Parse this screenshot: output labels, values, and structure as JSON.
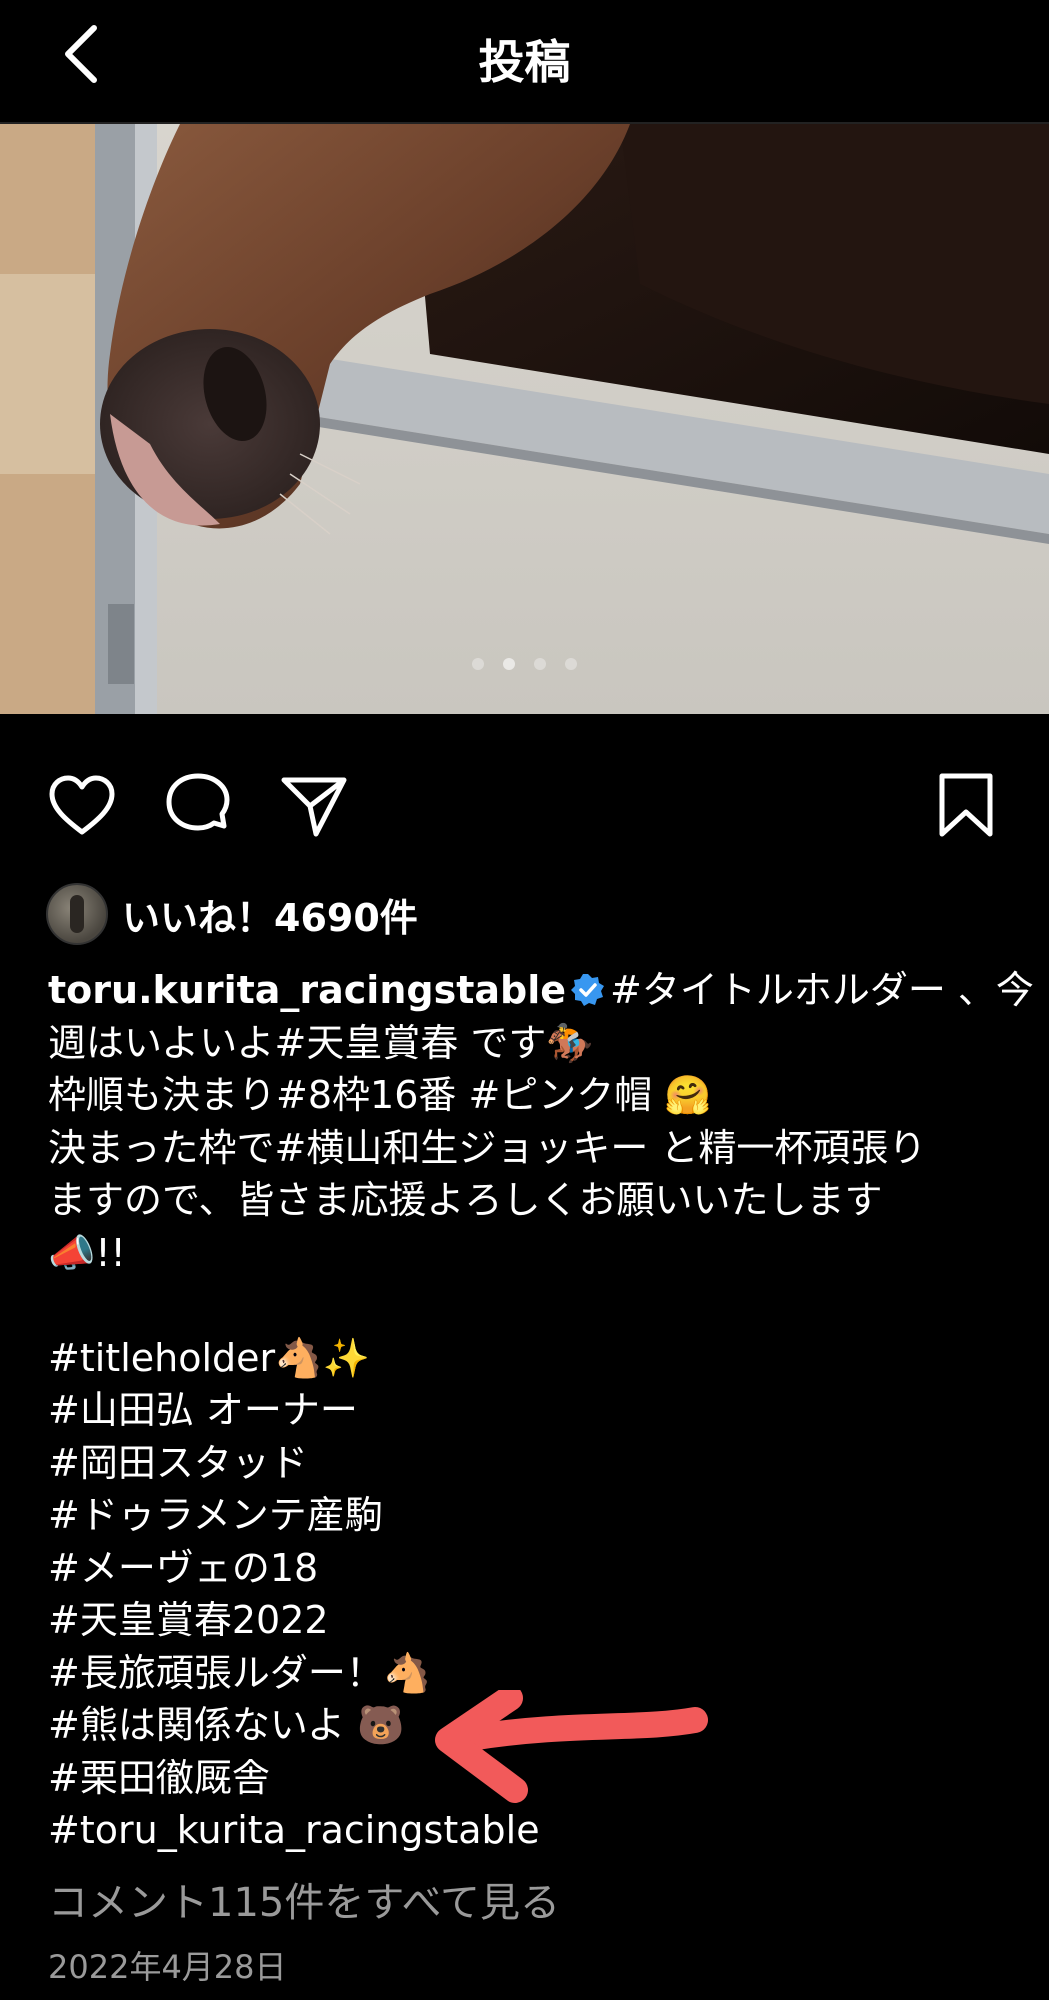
{
  "header": {
    "title": "投稿"
  },
  "photo": {
    "dots": 4,
    "active_dot": 2
  },
  "likes": {
    "text": "いいね！4690件"
  },
  "caption": {
    "username": "toru.kurita_racingstable",
    "lines": [
      "#タイトルホルダー 、今",
      "週はいよいよ#天皇賞春 です🏇",
      "枠順も決まり#8枠16番 #ピンク帽 🤗",
      "決まった枠で#横山和生ジョッキー と精一杯頑張り",
      "ますので、皆さま応援よろしくお願いいたします",
      "📣!!",
      "",
      "#titleholder🐴✨",
      "#山田弘 オーナー",
      "#岡田スタッド",
      "#ドゥラメンテ産駒",
      "#メーヴェの18",
      "#天皇賞春2022",
      "#長旅頑張ルダー！🐴",
      "#熊は関係ないよ 🐻",
      "#栗田徹厩舎",
      "#toru_kurita_racingstable"
    ]
  },
  "comments_link": "コメント115件をすべて見る",
  "date": "2022年4月28日",
  "colors": {
    "background": "#000000",
    "verified": "#3897f0",
    "annotation_arrow": "#f25a5a"
  }
}
